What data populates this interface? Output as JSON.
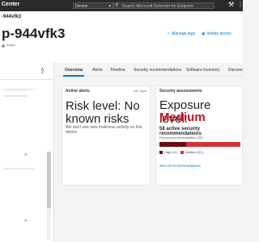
{
  "topbar": {
    "app_title": "Center",
    "device_selector": "Device",
    "search_placeholder": "Search Microsoft Defender for Endpoint"
  },
  "header": {
    "device_id": "-944vfk3",
    "device_name": "p-944vfk3",
    "status": "Active",
    "actions": [
      "Manage tags",
      "Isolate device"
    ]
  },
  "tabs": [
    "Overview",
    "Alerts",
    "Timeline",
    "Security recommendations",
    "Software inventory",
    "Discove"
  ],
  "active_alerts": {
    "title": "Active alerts",
    "meta": "180 days",
    "risk": "Risk level: No known risks",
    "description": "We don't see new malicious activity on this device"
  },
  "security_assessments": {
    "title": "Security assessments",
    "exposure_label": "Exposure level:",
    "exposure_value": "Medium",
    "recommendations": "58 active security recommendations",
    "vuln_label": "Discovered vulnerabilities (33)",
    "high_count": 11,
    "medium_count": 22,
    "legend_high": "High (11)",
    "legend_medium": "Medium (22)",
    "see_all": "See all recommendations",
    "colors": {
      "high": "#6e0a12",
      "medium": "#d13438"
    }
  }
}
